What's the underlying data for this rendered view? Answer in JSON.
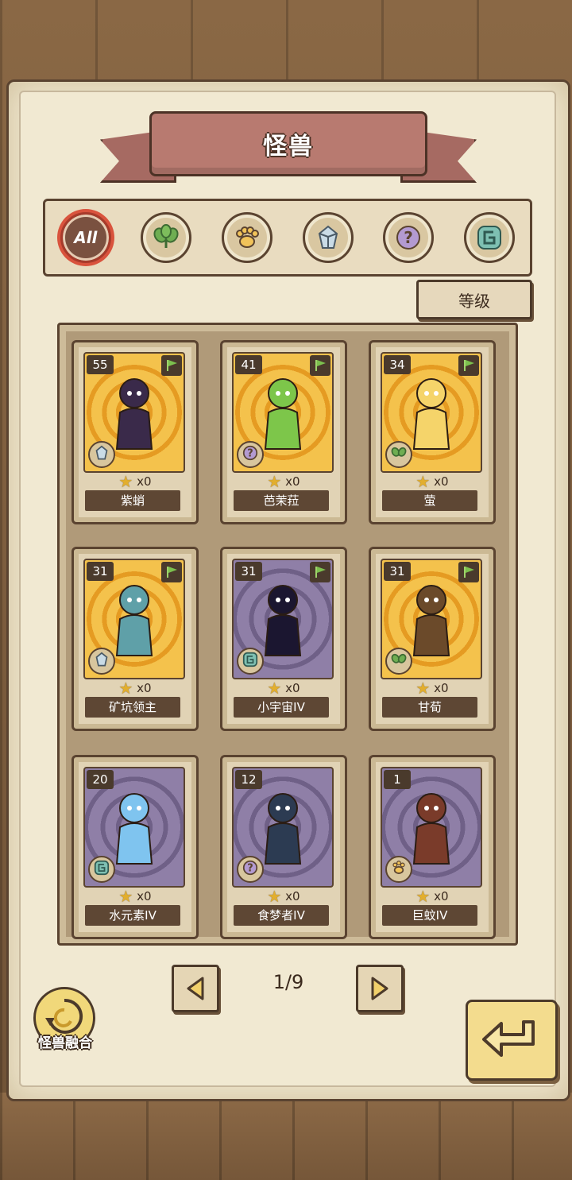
{
  "header": {
    "title": "怪兽"
  },
  "filters": [
    {
      "label": "All",
      "icon": "all-text-icon",
      "active": true
    },
    {
      "label": "",
      "icon": "leaf-icon",
      "active": false
    },
    {
      "label": "",
      "icon": "paw-icon",
      "active": false
    },
    {
      "label": "",
      "icon": "crystal-icon",
      "active": false
    },
    {
      "label": "",
      "icon": "question-icon",
      "active": false
    },
    {
      "label": "",
      "icon": "spiral-icon",
      "active": false
    }
  ],
  "sort": {
    "label": "等级"
  },
  "cards": [
    {
      "level": "55",
      "name": "紫蛸",
      "count": "x0",
      "bg": "gold",
      "flag": true,
      "type_icon": "crystal-icon"
    },
    {
      "level": "41",
      "name": "芭茉菈",
      "count": "x0",
      "bg": "gold",
      "flag": true,
      "type_icon": "question-icon"
    },
    {
      "level": "34",
      "name": "萤",
      "count": "x0",
      "bg": "gold",
      "flag": true,
      "type_icon": "leaf-icon"
    },
    {
      "level": "31",
      "name": "矿坑领主",
      "count": "x0",
      "bg": "gold",
      "flag": true,
      "type_icon": "crystal-icon"
    },
    {
      "level": "31",
      "name": "小宇宙IV",
      "count": "x0",
      "bg": "purple",
      "flag": true,
      "type_icon": "spiral-icon"
    },
    {
      "level": "31",
      "name": "甘荀",
      "count": "x0",
      "bg": "gold",
      "flag": true,
      "type_icon": "leaf-icon"
    },
    {
      "level": "20",
      "name": "水元素IV",
      "count": "x0",
      "bg": "purple",
      "flag": false,
      "type_icon": "spiral-icon"
    },
    {
      "level": "12",
      "name": "食梦者IV",
      "count": "x0",
      "bg": "purple",
      "flag": false,
      "type_icon": "question-icon"
    },
    {
      "level": "1",
      "name": "巨蚊IV",
      "count": "x0",
      "bg": "purple",
      "flag": false,
      "type_icon": "paw-icon"
    }
  ],
  "pagination": {
    "indicator": "1/9"
  },
  "fusion": {
    "label": "怪兽融合"
  },
  "colors": {
    "gold_bg": "#f4c24c",
    "purple_bg": "#8f7fa7",
    "dark_brown": "#5a4330",
    "parchment": "#efe6cd"
  }
}
